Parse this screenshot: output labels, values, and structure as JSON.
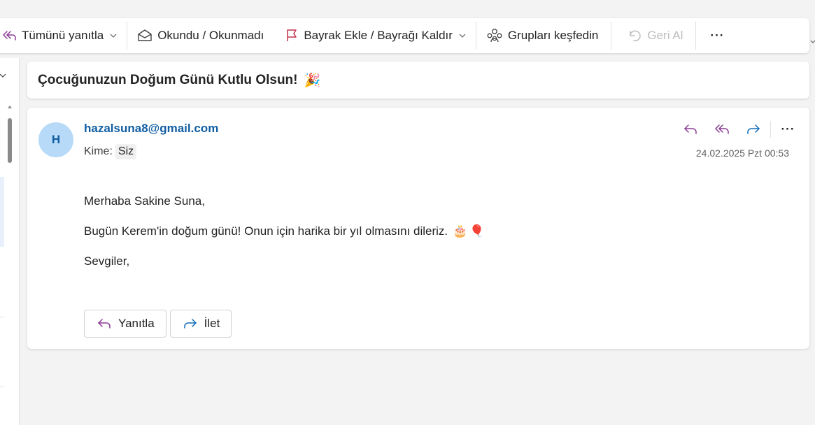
{
  "toolbar": {
    "reply_all": "Tümünü yanıtla",
    "read_unread": "Okundu / Okunmadı",
    "flag": "Bayrak Ekle / Bayrağı Kaldır",
    "groups": "Grupları keşfedin",
    "undo": "Geri Al",
    "more": "···"
  },
  "message": {
    "subject": "Çocuğunuzun Doğum Günü Kutlu Olsun!",
    "subject_emoji": "🎉",
    "avatar_initial": "H",
    "sender": "hazalsuna8@gmail.com",
    "to_label": "Kime:",
    "to_value": "Siz",
    "date": "24.02.2025 Pzt 00:53",
    "more": "···",
    "body": {
      "greeting": "Merhaba Sakine Suna,",
      "line1": "Bugün Kerem'in doğum günü! Onun için harika bir yıl olmasını dileriz.",
      "line1_emoji_1": "🎂",
      "line1_emoji_2": "🎈",
      "closing": "Sevgiler,"
    },
    "reply_button": "Yanıtla",
    "forward_button": "İlet"
  },
  "colors": {
    "accent_purple": "#8b3a96",
    "accent_blue": "#0f6cbd",
    "flag_red": "#c4314b",
    "sender_blue": "#115ea3",
    "avatar_bg": "#b6daf7"
  },
  "icons": {
    "reply_all": "reply-all-icon",
    "read_unread": "envelope-open-icon",
    "flag": "flag-icon",
    "groups": "people-community-icon",
    "undo": "undo-icon",
    "reply": "reply-icon",
    "forward": "forward-icon"
  }
}
